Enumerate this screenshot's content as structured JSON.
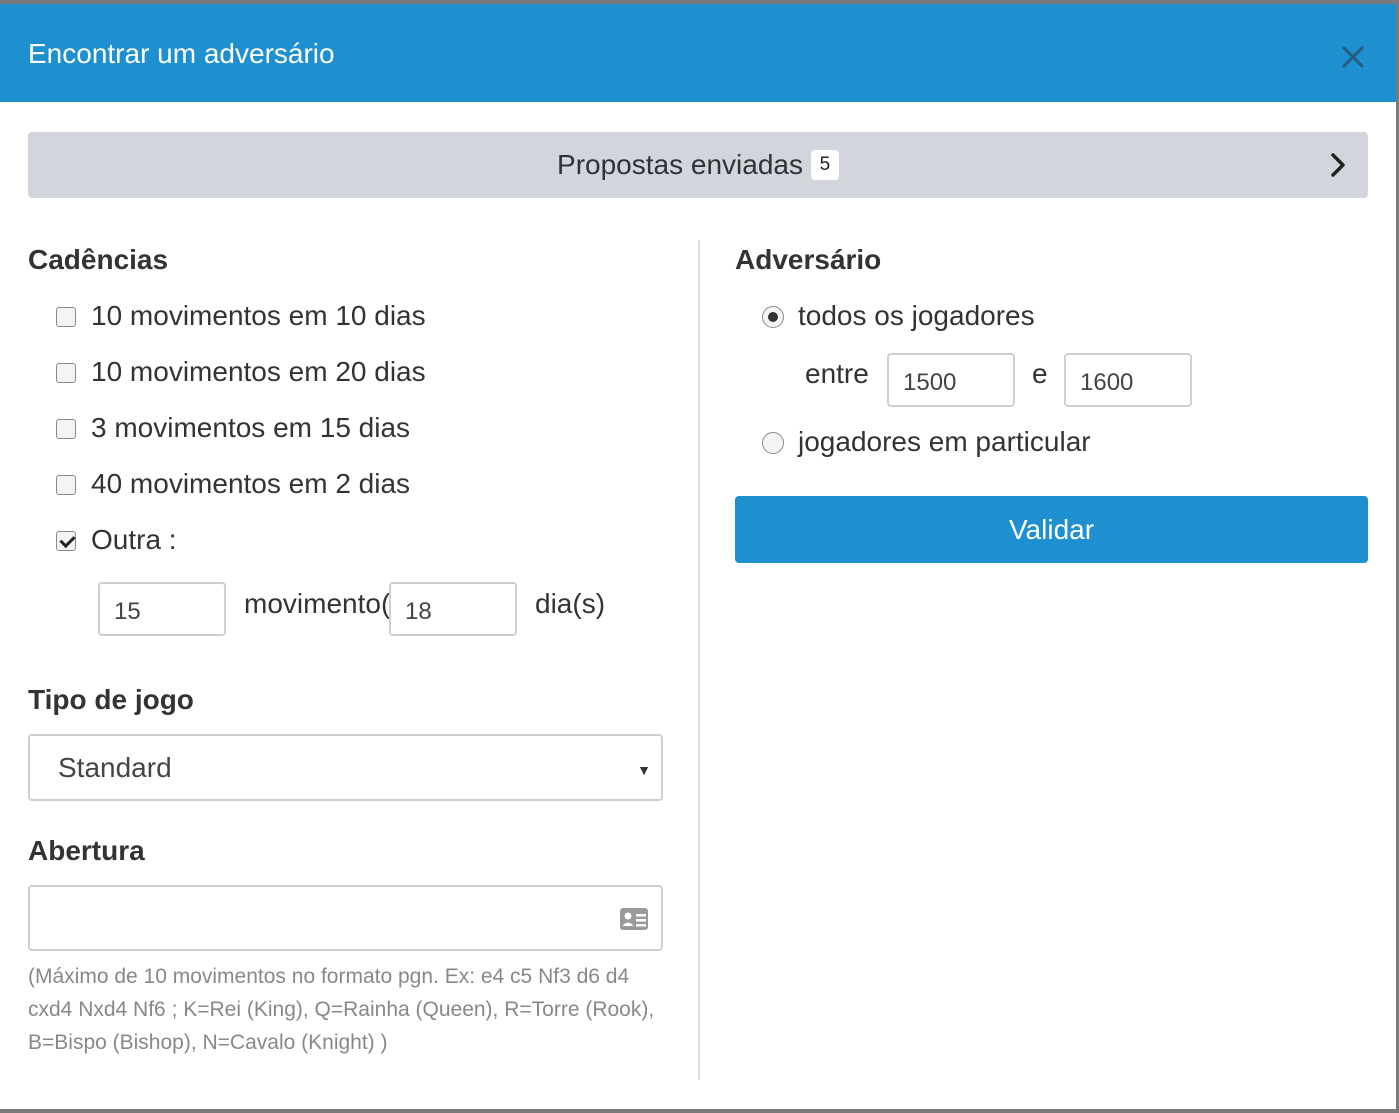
{
  "header": {
    "title": "Encontrar um adversário",
    "close_icon": "close-icon"
  },
  "proposals": {
    "label": "Propostas enviadas",
    "count": "5"
  },
  "cadences": {
    "title": "Cadências",
    "items": [
      {
        "label": "10 movimentos em 10 dias",
        "checked": false
      },
      {
        "label": "10 movimentos em 20 dias",
        "checked": false
      },
      {
        "label": "3 movimentos em 15 dias",
        "checked": false
      },
      {
        "label": "40 movimentos em 2 dias",
        "checked": false
      },
      {
        "label": "Outra :",
        "checked": true
      }
    ],
    "custom": {
      "moves_value": "15",
      "moves_label": "movimento(",
      "days_value": "18",
      "days_label": "dia(s)"
    }
  },
  "game_type": {
    "title": "Tipo de jogo",
    "selected": "Standard"
  },
  "opening": {
    "title": "Abertura",
    "value": "",
    "help": "(Máximo de 10 movimentos no formato pgn. Ex: e4 c5 Nf3 d6 d4 cxd4 Nxd4 Nf6 ; K=Rei (King), Q=Rainha (Queen), R=Torre (Rook), B=Bispo (Bishop), N=Cavalo (Knight) )"
  },
  "opponent": {
    "title": "Adversário",
    "all_players_label": "todos os jogadores",
    "between_label": "entre",
    "and_label": "e",
    "min_rating": "1500",
    "max_rating": "1600",
    "specific_label": "jogadores em particular",
    "selected": "all"
  },
  "validate_label": "Validar",
  "colors": {
    "header": "#1e90cf",
    "button": "#1e90cf",
    "bar": "#d2d6dc"
  }
}
